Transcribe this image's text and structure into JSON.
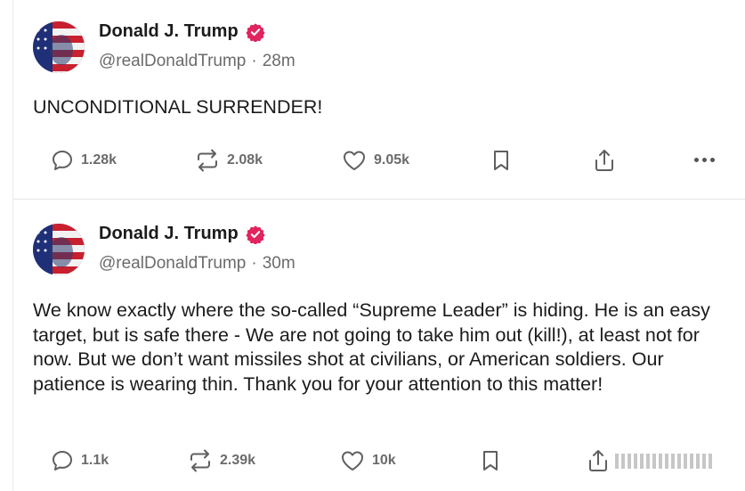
{
  "colors": {
    "accent": "#e0245e",
    "text": "#1b1b1b",
    "muted": "#6b6b6b"
  },
  "posts": [
    {
      "author_name": "Donald J. Trump",
      "handle": "@realDonaldTrump",
      "separator": "·",
      "time": "28m",
      "text": "UNCONDITIONAL SURRENDER!",
      "replies": "1.28k",
      "reposts": "2.08k",
      "likes": "9.05k"
    },
    {
      "author_name": "Donald J. Trump",
      "handle": "@realDonaldTrump",
      "separator": "·",
      "time": "30m",
      "text": "We know exactly where the so-called “Supreme Leader” is hiding. He is an easy target, but is safe there - We are not going to take him out (kill!), at least not for now. But we don’t want missiles shot at civilians, or American soldiers. Our patience is wearing thin. Thank you for your attention to this matter!",
      "replies": "1.1k",
      "reposts": "2.39k",
      "likes": "10k"
    }
  ],
  "icons": {
    "reply": "speech-bubble-icon",
    "repost": "repost-arrows-icon",
    "like": "heart-icon",
    "bookmark": "bookmark-icon",
    "share": "share-icon",
    "more": "more-dots-icon",
    "verified": "verified-badge-icon"
  }
}
